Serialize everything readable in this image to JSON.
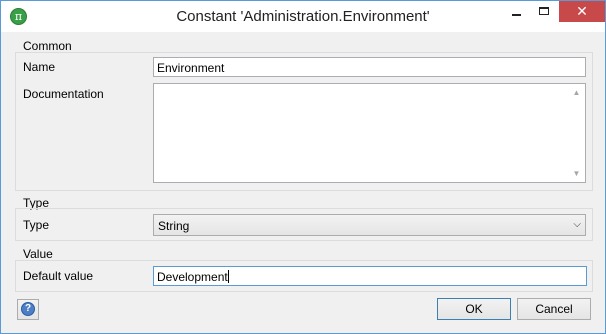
{
  "window": {
    "title": "Constant 'Administration.Environment'",
    "app_icon_glyph": "π",
    "close_glyph": "✕"
  },
  "sections": {
    "common": "Common",
    "type": "Type",
    "value": "Value"
  },
  "fields": {
    "name_label": "Name",
    "name_value": "Environment",
    "documentation_label": "Documentation",
    "documentation_value": "",
    "type_label": "Type",
    "type_value": "String",
    "default_value_label": "Default value",
    "default_value_value": "Development"
  },
  "buttons": {
    "ok": "OK",
    "cancel": "Cancel",
    "help_glyph": "?"
  },
  "icons": {
    "app": "mendix-constant-icon",
    "help": "help-icon",
    "dropdown": "chevron-down-icon"
  },
  "colors": {
    "titlebar": "#ffffff",
    "window_bg": "#f0f0f0",
    "close_button": "#c7494a",
    "window_border": "#5b9bd5",
    "app_icon": "#3aa048"
  }
}
